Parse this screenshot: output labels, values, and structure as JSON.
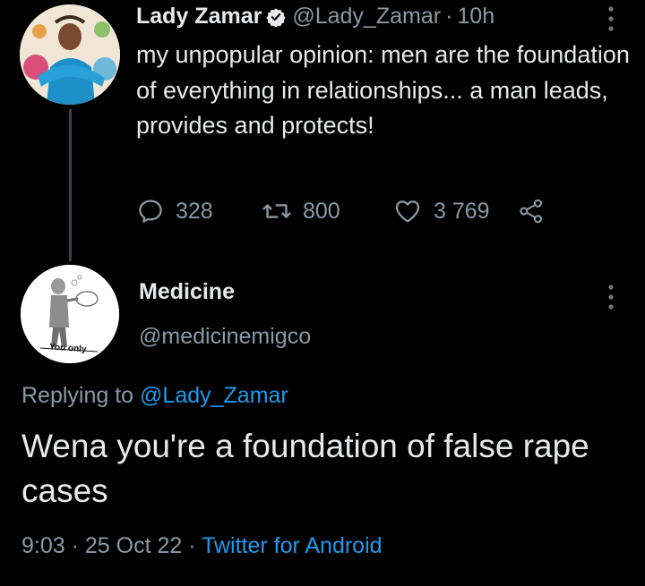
{
  "tweet": {
    "display_name": "Lady Zamar",
    "handle": "@Lady_Zamar",
    "separator": "·",
    "time": "10h",
    "text": "my unpopular opinion: men are the foundation of everything in relationships... a man leads, provides and protects!",
    "replies": "328",
    "retweets": "800",
    "likes": "3 769"
  },
  "reply": {
    "display_name": "Medicine",
    "handle": "@medicinemigco",
    "avatar_caption": "You only",
    "replying_prefix": "Replying to ",
    "replying_to": "@Lady_Zamar",
    "text": "Wena you're a foundation of false rape cases",
    "time": "9:03",
    "sep1": " · ",
    "date": "25 Oct 22",
    "sep2": " · ",
    "source": "Twitter for Android"
  },
  "colors": {
    "background": "#000000",
    "text_primary": "#e7e9ea",
    "text_secondary": "#8b98a5",
    "link": "#1d9bf0",
    "thread_line": "#3d4145"
  },
  "icons": [
    "verified-badge-icon",
    "more-icon",
    "reply-icon",
    "retweet-icon",
    "like-icon",
    "share-icon"
  ]
}
